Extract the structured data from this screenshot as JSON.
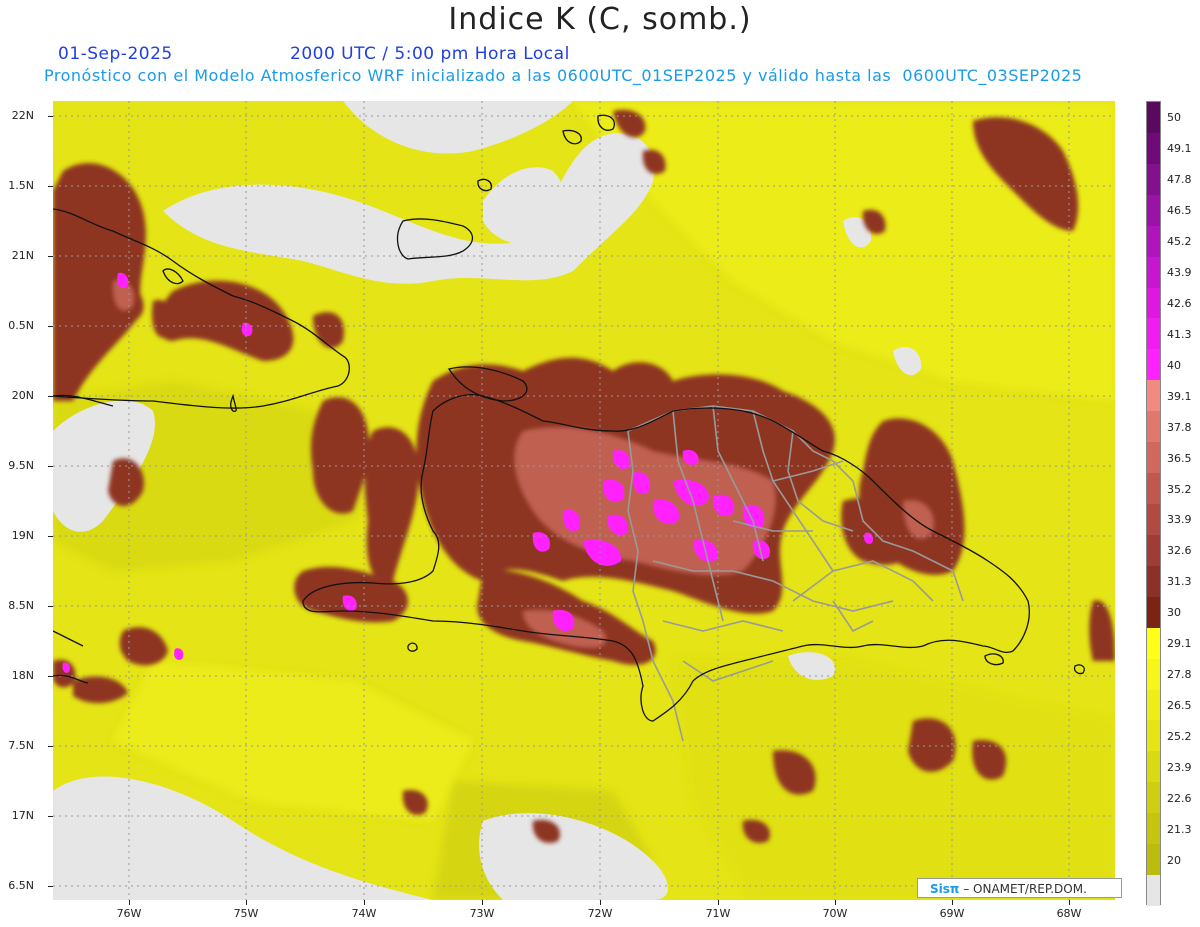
{
  "header": {
    "title": "Indice K (C, somb.)",
    "date": "01-Sep-2025",
    "time": "2000 UTC / 5:00 pm Hora Local",
    "subtitle": "Pronóstico con el Modelo Atmosferico WRF inicializado a las 0600UTC_01SEP2025 y válido hasta las  0600UTC_03SEP2025"
  },
  "axes": {
    "lat_labels": [
      "22N",
      "1.5N",
      "21N",
      "0.5N",
      "20N",
      "9.5N",
      "19N",
      "8.5N",
      "18N",
      "7.5N",
      "17N",
      "6.5N"
    ],
    "lon_labels": [
      "76W",
      "75W",
      "74W",
      "73W",
      "72W",
      "71W",
      "70W",
      "69W",
      "68W"
    ]
  },
  "colorbar": {
    "labels": [
      "50",
      "49.1",
      "47.8",
      "46.5",
      "45.2",
      "43.9",
      "42.6",
      "41.3",
      "40",
      "39.1",
      "37.8",
      "36.5",
      "35.2",
      "33.9",
      "32.6",
      "31.3",
      "30",
      "29.1",
      "27.8",
      "26.5",
      "25.2",
      "23.9",
      "22.6",
      "21.3",
      "20"
    ],
    "colors": [
      "#5a0a5e",
      "#6f0a78",
      "#84108f",
      "#9a12a6",
      "#b014bd",
      "#c816d0",
      "#de18e2",
      "#f01cf2",
      "#ff22ff",
      "#f08a82",
      "#e0786e",
      "#d0685e",
      "#c05850",
      "#b04a42",
      "#a03c36",
      "#8e302a",
      "#7c2414",
      "#ffff1a",
      "#f6f61a",
      "#eded18",
      "#e4e416",
      "#d9d914",
      "#cfcf12",
      "#c5c510",
      "#bcbc0e",
      "#e6e6e6"
    ]
  },
  "credit": {
    "brand": "Sisπ",
    "text": " – ONAMET/REP.DOM."
  }
}
